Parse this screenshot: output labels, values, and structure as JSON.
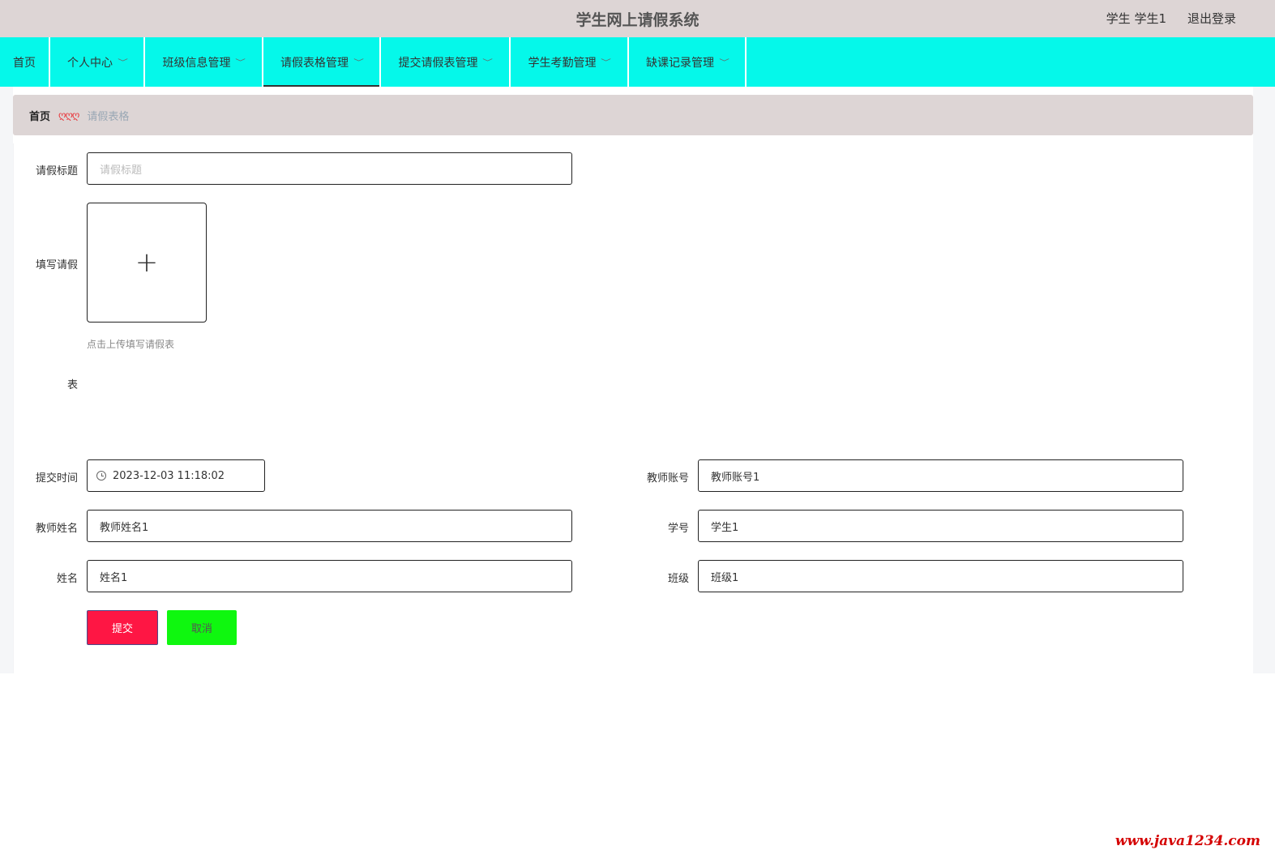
{
  "header": {
    "title": "学生网上请假系统",
    "user_label": "学生 学生1",
    "logout": "退出登录"
  },
  "nav": {
    "items": [
      {
        "label": "首页",
        "has_dropdown": false
      },
      {
        "label": "个人中心",
        "has_dropdown": true
      },
      {
        "label": "班级信息管理",
        "has_dropdown": true
      },
      {
        "label": "请假表格管理",
        "has_dropdown": true,
        "active": true
      },
      {
        "label": "提交请假表管理",
        "has_dropdown": true
      },
      {
        "label": "学生考勤管理",
        "has_dropdown": true
      },
      {
        "label": "缺课记录管理",
        "has_dropdown": true
      }
    ],
    "chevron": "﹀"
  },
  "breadcrumb": {
    "home": "首页",
    "separator": "ღღღ",
    "current": "请假表格"
  },
  "form": {
    "title_label": "请假标题",
    "title_placeholder": "请假标题",
    "upload_label_line1": "填写请假",
    "upload_label_line2": "表",
    "upload_plus": "+",
    "upload_tip": "点击上传填写请假表",
    "submit_time_label": "提交时间",
    "submit_time_value": "2023-12-03 11:18:02",
    "teacher_account_label": "教师账号",
    "teacher_account_value": "教师账号1",
    "teacher_name_label": "教师姓名",
    "teacher_name_value": "教师姓名1",
    "student_id_label": "学号",
    "student_id_value": "学生1",
    "name_label": "姓名",
    "name_value": "姓名1",
    "class_label": "班级",
    "class_value": "班级1",
    "submit_button": "提交",
    "cancel_button": "取消"
  },
  "watermark": "www.java1234.com",
  "colors": {
    "header_bg": "#ddd5d5",
    "nav_bg": "#05f8ea",
    "submit_bg": "#fe1644",
    "cancel_bg": "#0ff70f",
    "breadcrumb_separator": "#e8383d",
    "watermark": "#d40000"
  }
}
